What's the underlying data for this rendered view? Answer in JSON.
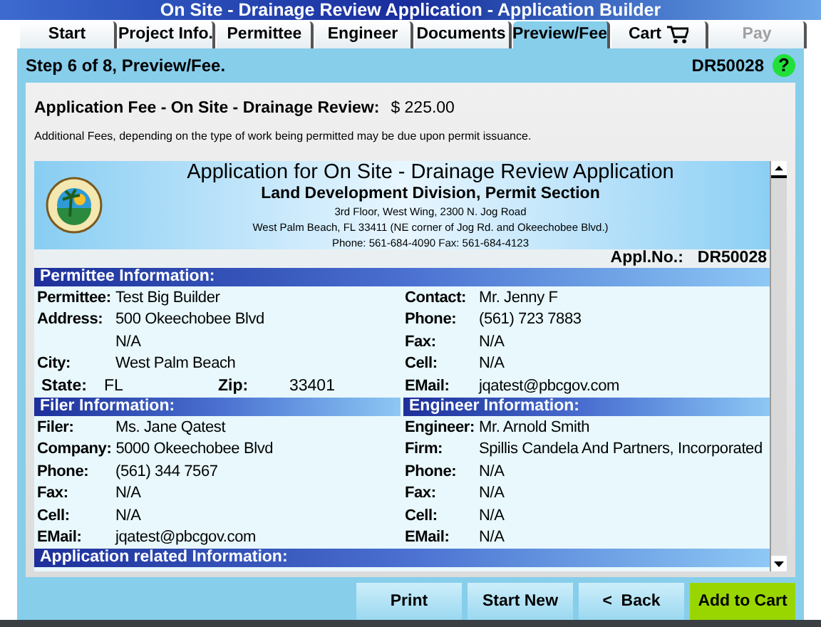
{
  "window": {
    "title": "On Site - Drainage Review Application - Application Builder"
  },
  "tabs": [
    {
      "label": "Start",
      "kind": "text",
      "selected": false,
      "disabled": false
    },
    {
      "label": "Project Info.",
      "kind": "text",
      "selected": false,
      "disabled": false
    },
    {
      "label": "Permittee",
      "kind": "text",
      "selected": false,
      "disabled": false
    },
    {
      "label": "Engineer",
      "kind": "text",
      "selected": false,
      "disabled": false
    },
    {
      "label": "Documents",
      "kind": "text",
      "selected": false,
      "disabled": false
    },
    {
      "label": "Preview/Fee",
      "kind": "text",
      "selected": true,
      "disabled": false
    },
    {
      "label": "Cart",
      "kind": "cart",
      "selected": false,
      "disabled": false
    },
    {
      "label": "Pay",
      "kind": "text",
      "selected": false,
      "disabled": true
    }
  ],
  "step": {
    "title": "Step 6 of 8, Preview/Fee.",
    "application_id": "DR50028",
    "help": "?"
  },
  "fee": {
    "label": "Application Fee - On Site - Drainage Review:",
    "amount": "$ 225.00",
    "note": "Additional Fees, depending on the type of work being permitted may be due upon permit issuance."
  },
  "document": {
    "title": "Application for On Site - Drainage Review Application",
    "subtitle": "Land Development Division, Permit Section",
    "address_lines": [
      "3rd Floor, West Wing, 2300 N. Jog Road",
      "West Palm Beach, FL 33411 (NE corner of Jog Rd. and Okeechobee Blvd.)",
      "Phone: 561-684-4090 Fax: 561-684-4123"
    ],
    "appl_no_label": "Appl.No.:",
    "appl_no": "DR50028",
    "permittee": {
      "heading": "Permittee Information:",
      "left": [
        {
          "kind": "field",
          "label": "Permittee:",
          "value": "Test Big Builder"
        },
        {
          "kind": "field",
          "label": "Address:",
          "value": "500 Okeechobee Blvd"
        },
        {
          "kind": "field",
          "value": "N/A"
        },
        {
          "kind": "field",
          "label": "City:",
          "value": "West Palm Beach"
        },
        {
          "kind": "pair",
          "label": "State:",
          "value": "FL",
          "label2": "Zip:",
          "value2": "33401"
        }
      ],
      "right": [
        {
          "kind": "field",
          "label": "Contact:",
          "value": "Mr. Jenny F"
        },
        {
          "kind": "field",
          "label": "Phone:",
          "value": "(561) 723 7883"
        },
        {
          "kind": "field",
          "label": "Fax:",
          "value": "N/A"
        },
        {
          "kind": "field",
          "label": "Cell:",
          "value": "N/A"
        },
        {
          "kind": "field",
          "label": "EMail:",
          "value": "jqatest@pbcgov.com"
        }
      ]
    },
    "filer": {
      "heading": "Filer Information:",
      "rows": [
        {
          "label": "Filer:",
          "value": "Ms. Jane Qatest"
        },
        {
          "label": "Company:",
          "value": "5000 Okeechobee Blvd"
        },
        {
          "label": "Phone:",
          "value": "(561) 344 7567"
        },
        {
          "label": "Fax:",
          "value": "N/A"
        },
        {
          "label": "Cell:",
          "value": "N/A"
        },
        {
          "label": "EMail:",
          "value": "jqatest@pbcgov.com"
        }
      ]
    },
    "engineer": {
      "heading": "Engineer Information:",
      "rows": [
        {
          "label": "Engineer:",
          "value": "Mr. Arnold Smith"
        },
        {
          "label": "Firm:",
          "value": "Spillis Candela And Partners, Incorporated"
        },
        {
          "label": "Phone:",
          "value": "N/A"
        },
        {
          "label": "Fax:",
          "value": "N/A"
        },
        {
          "label": "Cell:",
          "value": "N/A"
        },
        {
          "label": "EMail:",
          "value": "N/A"
        }
      ]
    },
    "next_heading": "Application related Information:"
  },
  "buttons": [
    {
      "label": "Print",
      "kind": "normal"
    },
    {
      "label": "Start New",
      "kind": "normal"
    },
    {
      "label": "<  Back",
      "kind": "normal"
    },
    {
      "label": "Add to Cart",
      "kind": "primary"
    }
  ]
}
